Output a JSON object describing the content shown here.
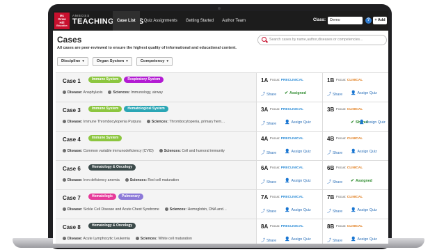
{
  "header": {
    "logo_text": [
      "Mc",
      "Graw",
      "Hill",
      "Education"
    ],
    "brand_small": "AMBOSS",
    "brand_big": "TEACHING CASES",
    "nav": [
      "Case List",
      "Quiz Assignments",
      "Getting Started",
      "Author Team"
    ],
    "class_label": "Class:",
    "class_value": "Demo",
    "help": "?",
    "add_label": "+ Add"
  },
  "page": {
    "title": "Cases",
    "subtitle": "All cases are peer-reviewed to ensure the highest quality of informational and educational content.",
    "search_placeholder": "Search cases by name,author,diseases or competencies...",
    "filters": [
      "Discipline",
      "Organ System",
      "Competency"
    ],
    "disease_label": "Disease:",
    "sciences_label": "Sciences:",
    "focus_label": "Focus:",
    "share_label": "Share",
    "assign_label": "Assign Quiz",
    "assigned_label": "Assigned",
    "shared_label": "Shared"
  },
  "colors": {
    "immune": "#8cc63f",
    "respiratory": "#b31bd3",
    "hematological": "#2aa6b5",
    "hematology_oncology": "#3b4a4a",
    "hematologic": "#e63a9a",
    "pulmonary": "#8c79d8"
  },
  "cases": [
    {
      "title": "Case 1",
      "tags": [
        {
          "label": "Immune System",
          "color": "#8cc63f"
        },
        {
          "label": "Respiratory System",
          "color": "#b31bd3"
        }
      ],
      "disease": "Anaphylaxis",
      "sciences": "Immunology, airway",
      "parts": [
        {
          "id": "1A",
          "focus": "PRECLINICAL",
          "status": "Assigned"
        },
        {
          "id": "1B",
          "focus": "CLINICAL",
          "status": "Assign Quiz"
        }
      ]
    },
    {
      "title": "Case 3",
      "tags": [
        {
          "label": "Immune System",
          "color": "#8cc63f"
        },
        {
          "label": "Hematological System",
          "color": "#2aa6b5"
        }
      ],
      "disease": "Immune Thrombocytopenia Purpura",
      "sciences": "Thrombocytopenia, primary hem…",
      "parts": [
        {
          "id": "3A",
          "focus": "PRECLINICAL",
          "status": "Assign Quiz"
        },
        {
          "id": "3B",
          "focus": "CLINICAL",
          "status": "Shared"
        }
      ]
    },
    {
      "title": "Case 4",
      "tags": [
        {
          "label": "Immune System",
          "color": "#8cc63f"
        }
      ],
      "disease": "Common variable immunodeficiency (CVID)",
      "sciences": "Cell and humoral immunity",
      "parts": [
        {
          "id": "4A",
          "focus": "PRECLINICAL",
          "status": "Assign Quiz"
        },
        {
          "id": "4B",
          "focus": "CLINICAL",
          "status": "Assign Quiz"
        }
      ]
    },
    {
      "title": "Case 6",
      "tags": [
        {
          "label": "Hematology & Oncology",
          "color": "#3b4a4a"
        }
      ],
      "disease": "Iron deficiency anemia",
      "sciences": "Red cell maturation",
      "parts": [
        {
          "id": "6A",
          "focus": "PRECLINICAL",
          "status": "Assign Quiz"
        },
        {
          "id": "6B",
          "focus": "CLINICAL",
          "status": "Assigned"
        }
      ]
    },
    {
      "title": "Case 7",
      "tags": [
        {
          "label": "Hematologic",
          "color": "#e63a9a"
        },
        {
          "label": "Pulmonary",
          "color": "#8c79d8"
        }
      ],
      "disease": "Sickle Cell Disease and Acute Chest Syndrome",
      "sciences": "Hemoglobin, DNA and…",
      "parts": [
        {
          "id": "7A",
          "focus": "PRECLINICAL",
          "status": "Assign Quiz"
        },
        {
          "id": "7B",
          "focus": "CLINICAL",
          "status": "Assign Quiz"
        }
      ]
    },
    {
      "title": "Case 8",
      "tags": [
        {
          "label": "Hematology & Oncology",
          "color": "#3b4a4a"
        }
      ],
      "disease": "Acute Lymphocytic Leukemia",
      "sciences": "White cell maturation",
      "parts": [
        {
          "id": "8A",
          "focus": "PRECLINICAL",
          "status": "Assign Quiz"
        },
        {
          "id": "8B",
          "focus": "CLINICAL",
          "status": "Assign Quiz"
        }
      ]
    }
  ]
}
